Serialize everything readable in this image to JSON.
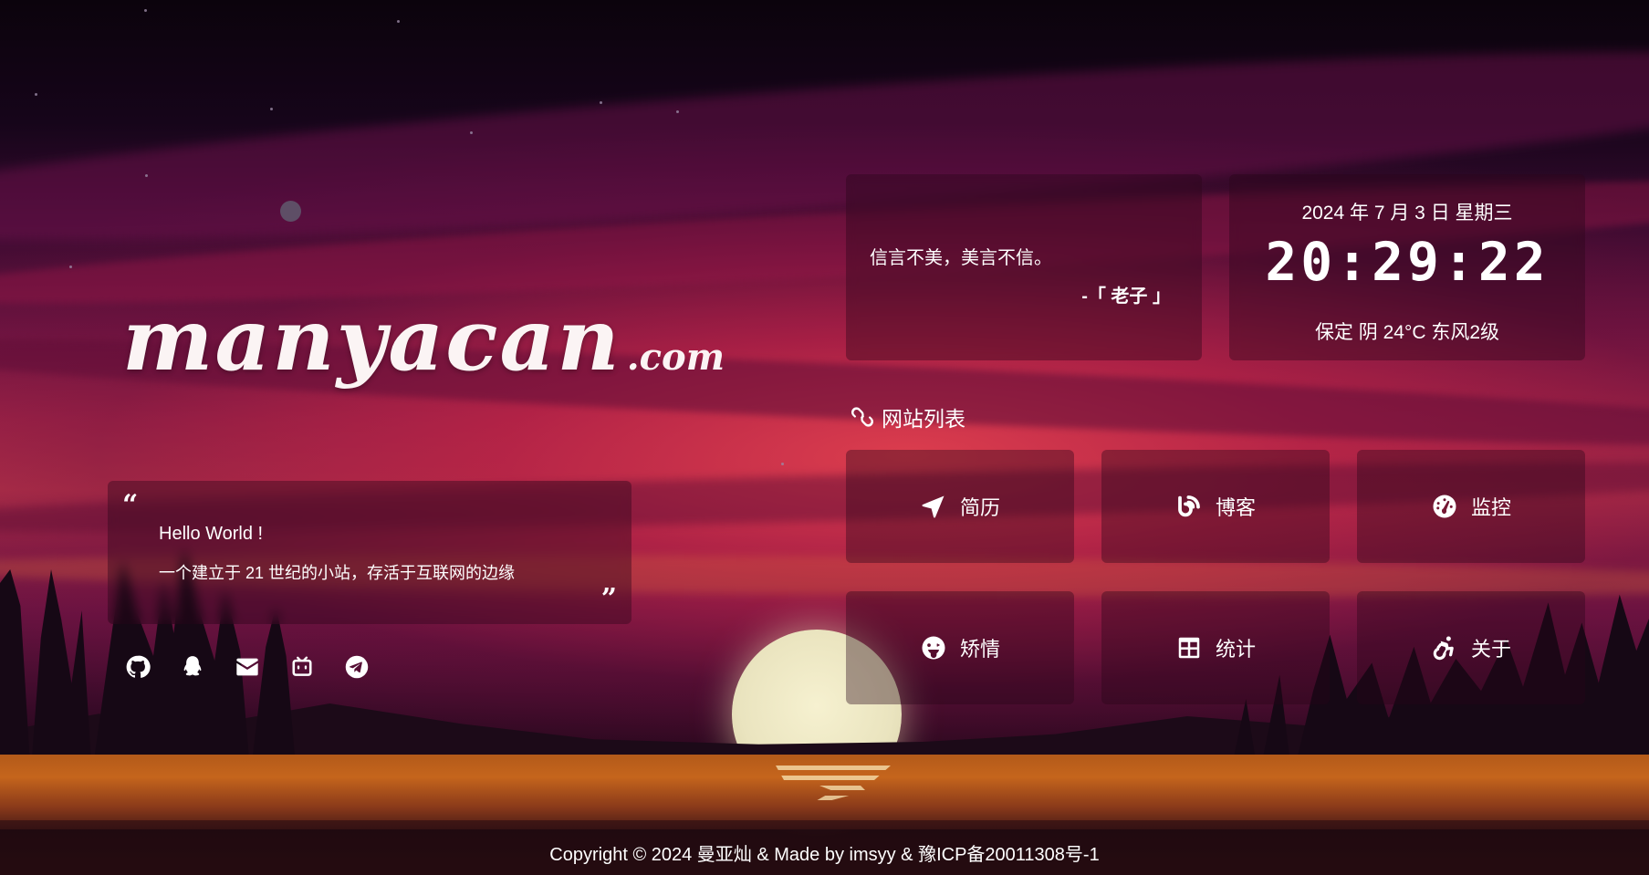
{
  "logo": {
    "main": "manyacan",
    "tld": ".com"
  },
  "intro": {
    "title": "Hello World !",
    "text": "一个建立于 21 世纪的小站，存活于互联网的边缘",
    "open_quote": "“",
    "close_quote": "”"
  },
  "social": [
    {
      "icon": "github-icon"
    },
    {
      "icon": "qq-icon"
    },
    {
      "icon": "email-icon"
    },
    {
      "icon": "bilibili-icon"
    },
    {
      "icon": "telegram-icon"
    }
  ],
  "hitokoto": {
    "text": "信言不美，美言不信。",
    "from": "-「 老子 」"
  },
  "time": {
    "date": "2024 年 7 月 3 日 星期三",
    "clock": "20:29:22",
    "weather": "保定 阴 24°C 东风2级"
  },
  "site_list": {
    "heading": "网站列表",
    "items": [
      {
        "label": "简历",
        "icon": "location-arrow-icon"
      },
      {
        "label": "博客",
        "icon": "blog-icon"
      },
      {
        "label": "监控",
        "icon": "gauge-icon"
      },
      {
        "label": "矫情",
        "icon": "tongue-face-icon"
      },
      {
        "label": "统计",
        "icon": "table-icon"
      },
      {
        "label": "关于",
        "icon": "accessibility-icon"
      }
    ]
  },
  "footer": {
    "text": "Copyright © 2024 曼亚灿 & Made by imsyy & 豫ICP备20011308号-1"
  },
  "colors": {
    "text": "#ffffff",
    "card_bg": "#28061860"
  }
}
